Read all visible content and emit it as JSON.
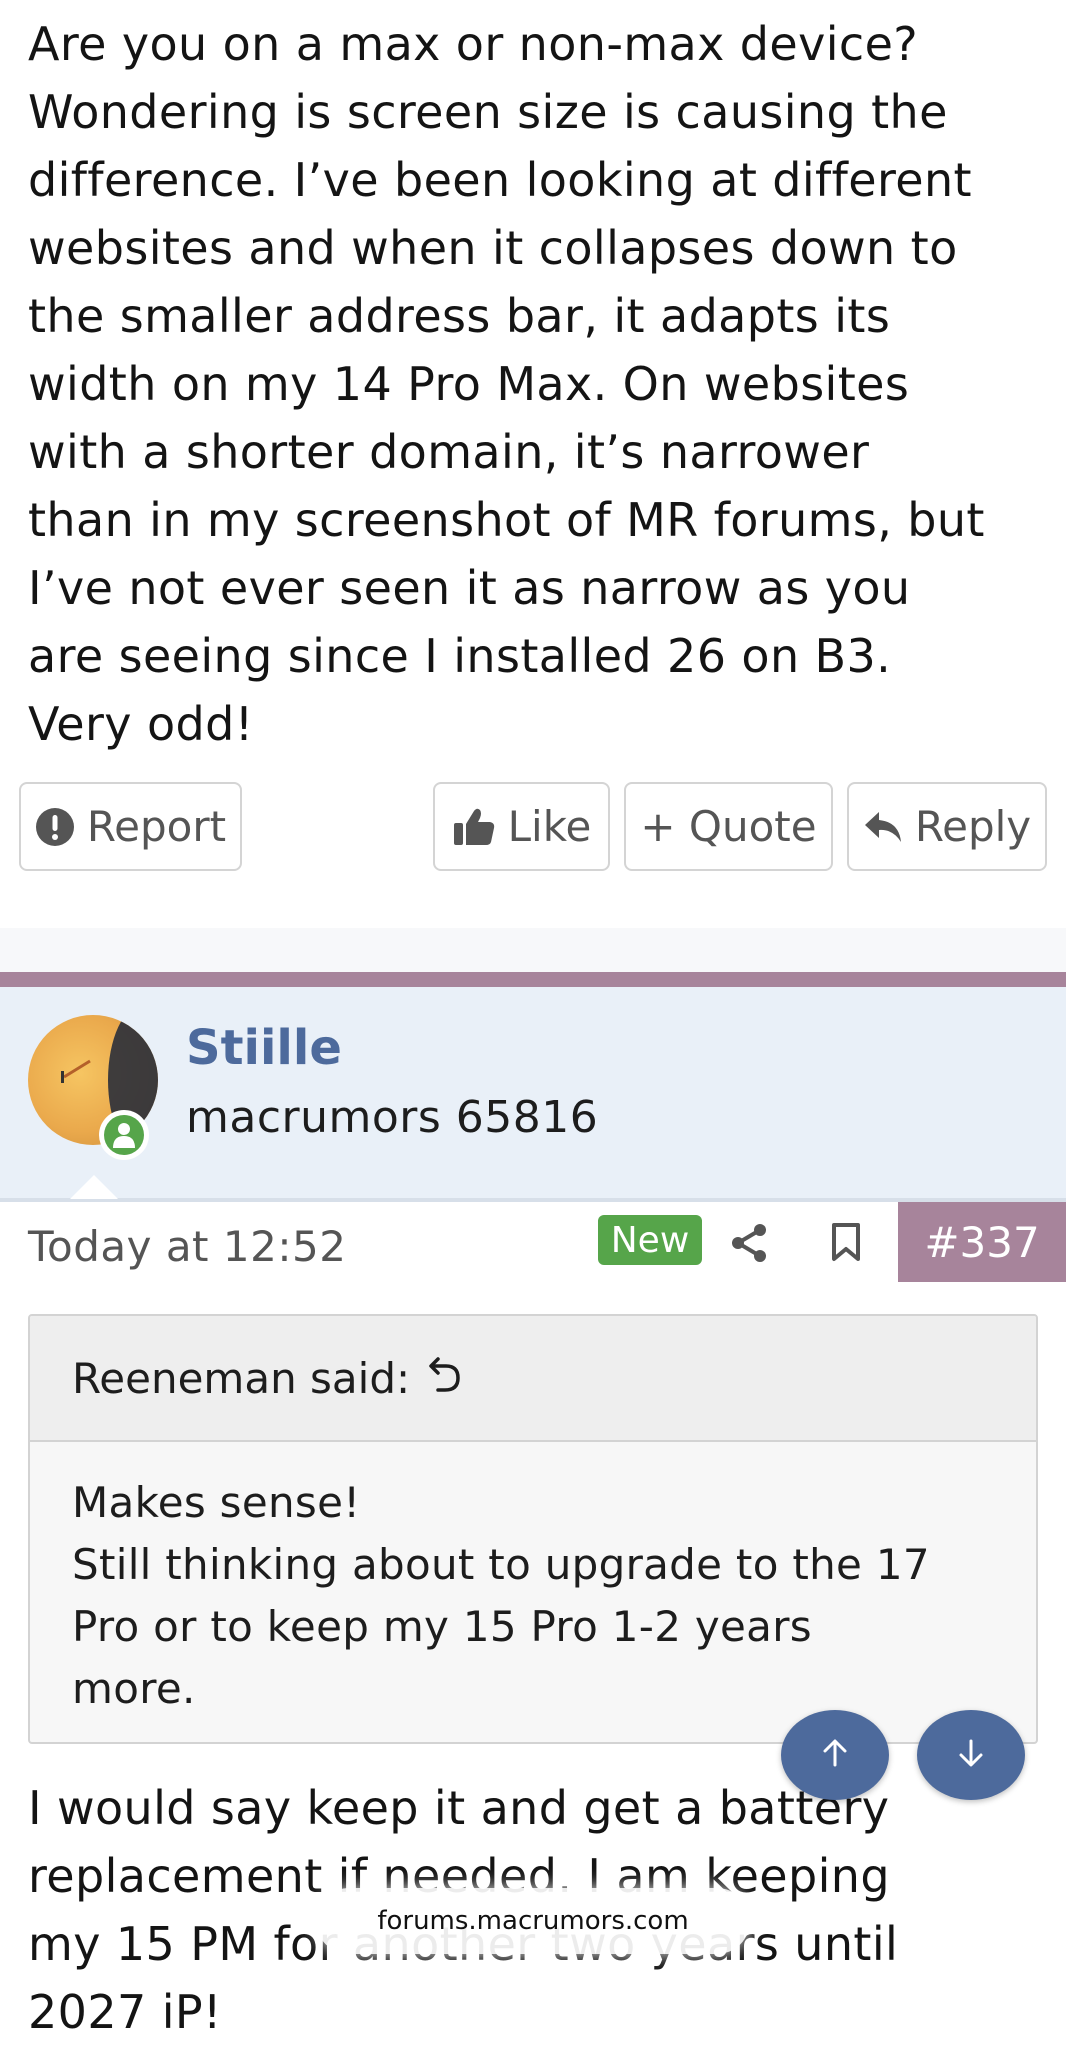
{
  "post": {
    "body": [
      "Are you on a max or non-max device?",
      "Wondering is screen size is causing the",
      "difference. I’ve been looking at different",
      "websites and when it collapses down to",
      "the smaller address bar, it adapts its",
      "width on my 14 Pro Max. On websites",
      "with a shorter domain, it’s narrower",
      "than in my screenshot of MR forums, but",
      "I’ve not ever seen it as narrow as you",
      "are seeing since I installed 26 on B3.",
      "Very odd!"
    ],
    "actions": {
      "report_label": "Report",
      "like_label": "Like",
      "quote_label": "+ Quote",
      "reply_label": "Reply"
    }
  },
  "next_post": {
    "username": "Stiille",
    "user_title": "macrumors 65816",
    "date": "Today at 12:52",
    "new_badge": "New",
    "post_number": "#337",
    "quote": {
      "author_line": "Reeneman said:",
      "lines": [
        "Makes sense!",
        "Still thinking about to upgrade to the 17",
        "Pro or to keep my 15 Pro 1-2 years",
        "more."
      ]
    },
    "reply_lines": [
      "I would say keep it and get a battery",
      "replacement if needed.  I am keeping",
      "my 15 PM for another two years until",
      "2027 iP!"
    ]
  },
  "browser": {
    "url": "forums.macrumors.com"
  },
  "icons": {
    "report": "exclamation-circle-icon",
    "like": "thumbs-up-icon",
    "reply": "reply-arrow-icon",
    "share": "share-icon",
    "bookmark": "bookmark-icon",
    "quote_jump": "undo-arrow-icon",
    "scroll_up": "arrow-up-icon",
    "scroll_down": "arrow-down-icon"
  },
  "colors": {
    "accent_purple": "#a7849b",
    "link_blue": "#4d6a9c",
    "new_green": "#56a54a",
    "user_band": "#e9f0f8"
  }
}
